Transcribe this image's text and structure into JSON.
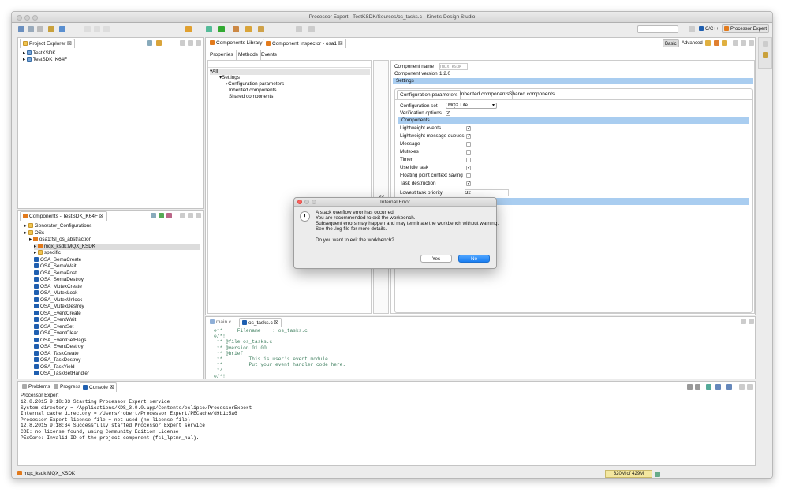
{
  "window": {
    "title": "Processor Expert - TestKSDK/Sources/os_tasks.c - Kinetis Design Studio"
  },
  "perspectives": {
    "cpp": "C/C++",
    "pe": "Processor Expert"
  },
  "project_explorer": {
    "tab": "Project Explorer ☒",
    "items": [
      "TestKSDK",
      "TestSDK_K64F"
    ]
  },
  "components_view": {
    "tab": "Components - TestSDK_K64F ☒",
    "items": [
      {
        "label": "Generator_Configurations",
        "depth": 1,
        "icon": "folder-icon"
      },
      {
        "label": "OSs",
        "depth": 1,
        "icon": "folder-icon"
      },
      {
        "label": "osa1:fsl_os_abstraction",
        "depth": 2,
        "icon": "component-icon"
      },
      {
        "label": "mqx_ksdk:MQX_KSDK",
        "depth": 3,
        "icon": "component-icon"
      },
      {
        "label": "specific",
        "depth": 3,
        "icon": "folder-icon"
      },
      {
        "label": "OSA_SemaCreate",
        "depth": 3,
        "icon": "method-icon"
      },
      {
        "label": "OSA_SemaWait",
        "depth": 3,
        "icon": "method-icon"
      },
      {
        "label": "OSA_SemaPost",
        "depth": 3,
        "icon": "method-icon"
      },
      {
        "label": "OSA_SemaDestroy",
        "depth": 3,
        "icon": "method-icon"
      },
      {
        "label": "OSA_MutexCreate",
        "depth": 3,
        "icon": "method-icon"
      },
      {
        "label": "OSA_MutexLock",
        "depth": 3,
        "icon": "method-icon"
      },
      {
        "label": "OSA_MutexUnlock",
        "depth": 3,
        "icon": "method-icon"
      },
      {
        "label": "OSA_MutexDestroy",
        "depth": 3,
        "icon": "method-icon"
      },
      {
        "label": "OSA_EventCreate",
        "depth": 3,
        "icon": "method-icon"
      },
      {
        "label": "OSA_EventWait",
        "depth": 3,
        "icon": "method-icon"
      },
      {
        "label": "OSA_EventSet",
        "depth": 3,
        "icon": "method-icon"
      },
      {
        "label": "OSA_EventClear",
        "depth": 3,
        "icon": "method-icon"
      },
      {
        "label": "OSA_EventGetFlags",
        "depth": 3,
        "icon": "method-icon"
      },
      {
        "label": "OSA_EventDestroy",
        "depth": 3,
        "icon": "method-icon"
      },
      {
        "label": "OSA_TaskCreate",
        "depth": 3,
        "icon": "method-icon"
      },
      {
        "label": "OSA_TaskDestroy",
        "depth": 3,
        "icon": "method-icon"
      },
      {
        "label": "OSA_TaskYield",
        "depth": 3,
        "icon": "method-icon"
      },
      {
        "label": "OSA_TaskGetHandler",
        "depth": 3,
        "icon": "method-icon"
      }
    ]
  },
  "editor_area": {
    "tabs": [
      "Components Library",
      "Component Inspector - osa1 ☒"
    ],
    "buttons": {
      "basic": "Basic",
      "advanced": "Advanced"
    },
    "subtabs": [
      "Properties",
      "Methods",
      "Events"
    ],
    "tree": [
      "All",
      "Settings",
      "Configuration parameters",
      "Inherited components",
      "Shared components"
    ],
    "collapse_label": "<<",
    "component_name_label": "Component name",
    "component_name_value": "mqx_ksdk",
    "component_version_label": "Component version",
    "component_version_value": "1.2.0",
    "settings_header": "Settings",
    "inner_tabs": [
      "Configuration parameters",
      "Inherited components",
      "Shared components"
    ],
    "configuration_set_label": "Configuration set",
    "configuration_set_value": "MQX Lite",
    "verification_options_label": "Verification options",
    "components_header": "Components",
    "options": [
      {
        "label": "Lightweight events",
        "checked": "✓"
      },
      {
        "label": "Lightweight message queues",
        "checked": "✓"
      },
      {
        "label": "Message",
        "checked": ""
      },
      {
        "label": "Mutexes",
        "checked": ""
      },
      {
        "label": "Timer",
        "checked": ""
      },
      {
        "label": "Use idle task",
        "checked": "✓"
      },
      {
        "label": "Floating point context saving",
        "checked": ""
      },
      {
        "label": "Task destruction",
        "checked": "✓"
      }
    ],
    "lowest_task_priority_label": "Lowest task priority",
    "lowest_task_priority_value": "32"
  },
  "source_editor": {
    "tabs": [
      "main.c",
      "os_tasks.c ☒"
    ],
    "lines": [
      "⊕**     Filename    : os_tasks.c",
      "⊖/*!",
      " ** @file os_tasks.c",
      " ** @version 01.00",
      " ** @brief",
      " **         This is user's event module.",
      " **         Put your event handler code here.",
      " */",
      "⊖/*!"
    ]
  },
  "console": {
    "tabs": [
      "Problems",
      "Progress",
      "Console ☒"
    ],
    "header": "Processor Expert",
    "lines": [
      "12.8.2015 9:18:33 Starting Processor Expert service",
      "System directory = /Applications/KDS_3.0.0.app/Contents/eclipse/ProcessorExpert",
      "Internal cache directory = /Users/robert/Processor Expert/PECache/d9b1c5a6",
      "Processor Expert license file = not used (no license file)",
      "12.8.2015 9:18:34 Successfully started Processor Expert service",
      "CDE: no license found, using Community Edition License",
      "PExCore: Invalid ID of the project component (fsl_lptmr_hal)."
    ]
  },
  "status_bar": {
    "selection": "mqx_ksdk:MQX_KSDK",
    "heap": "320M of 429M"
  },
  "dialog": {
    "title": "Internal Error",
    "lines": [
      "A stack overflow error has occurred.",
      "You are recommended to exit the workbench.",
      "Subsequent errors may happen and may terminate the workbench without warning.",
      "See the .log file for more details."
    ],
    "question": "Do you want to exit the workbench?",
    "yes": "Yes",
    "no": "No"
  },
  "colors": {
    "accent": "#1a8cff",
    "header_blue": "#a9cdf0",
    "code_comment": "#3f7f5f"
  }
}
